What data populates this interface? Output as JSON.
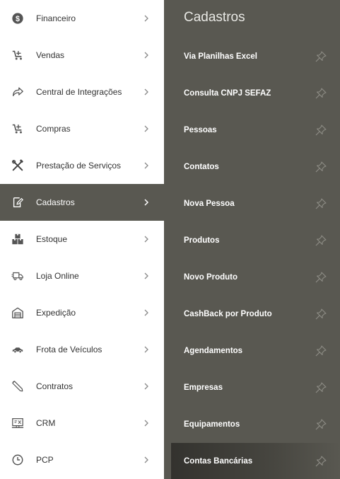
{
  "menu": {
    "items": [
      {
        "label": "Financeiro",
        "icon": "dollar-icon"
      },
      {
        "label": "Vendas",
        "icon": "cart-icon"
      },
      {
        "label": "Central de Integrações",
        "icon": "share-icon"
      },
      {
        "label": "Compras",
        "icon": "cart-icon"
      },
      {
        "label": "Prestação de Serviços",
        "icon": "tools-icon"
      },
      {
        "label": "Cadastros",
        "icon": "edit-icon",
        "active": true
      },
      {
        "label": "Estoque",
        "icon": "boxes-icon"
      },
      {
        "label": "Loja Online",
        "icon": "truck-icon"
      },
      {
        "label": "Expedição",
        "icon": "warehouse-icon"
      },
      {
        "label": "Frota de Veículos",
        "icon": "car-icon"
      },
      {
        "label": "Contratos",
        "icon": "pen-icon"
      },
      {
        "label": "CRM",
        "icon": "crm-icon"
      },
      {
        "label": "PCP",
        "icon": "clock-icon"
      }
    ]
  },
  "submenu": {
    "title": "Cadastros",
    "items": [
      {
        "label": "Via Planilhas Excel"
      },
      {
        "label": "Consulta CNPJ SEFAZ"
      },
      {
        "label": "Pessoas"
      },
      {
        "label": "Contatos"
      },
      {
        "label": "Nova Pessoa"
      },
      {
        "label": "Produtos"
      },
      {
        "label": "Novo Produto"
      },
      {
        "label": "CashBack por Produto"
      },
      {
        "label": "Agendamentos"
      },
      {
        "label": "Empresas"
      },
      {
        "label": "Equipamentos"
      },
      {
        "label": "Contas Bancárias",
        "highlighted": true
      }
    ]
  },
  "colors": {
    "panel": "#595851",
    "active_bg": "#595851",
    "text": "#333333",
    "icon": "#555555"
  }
}
